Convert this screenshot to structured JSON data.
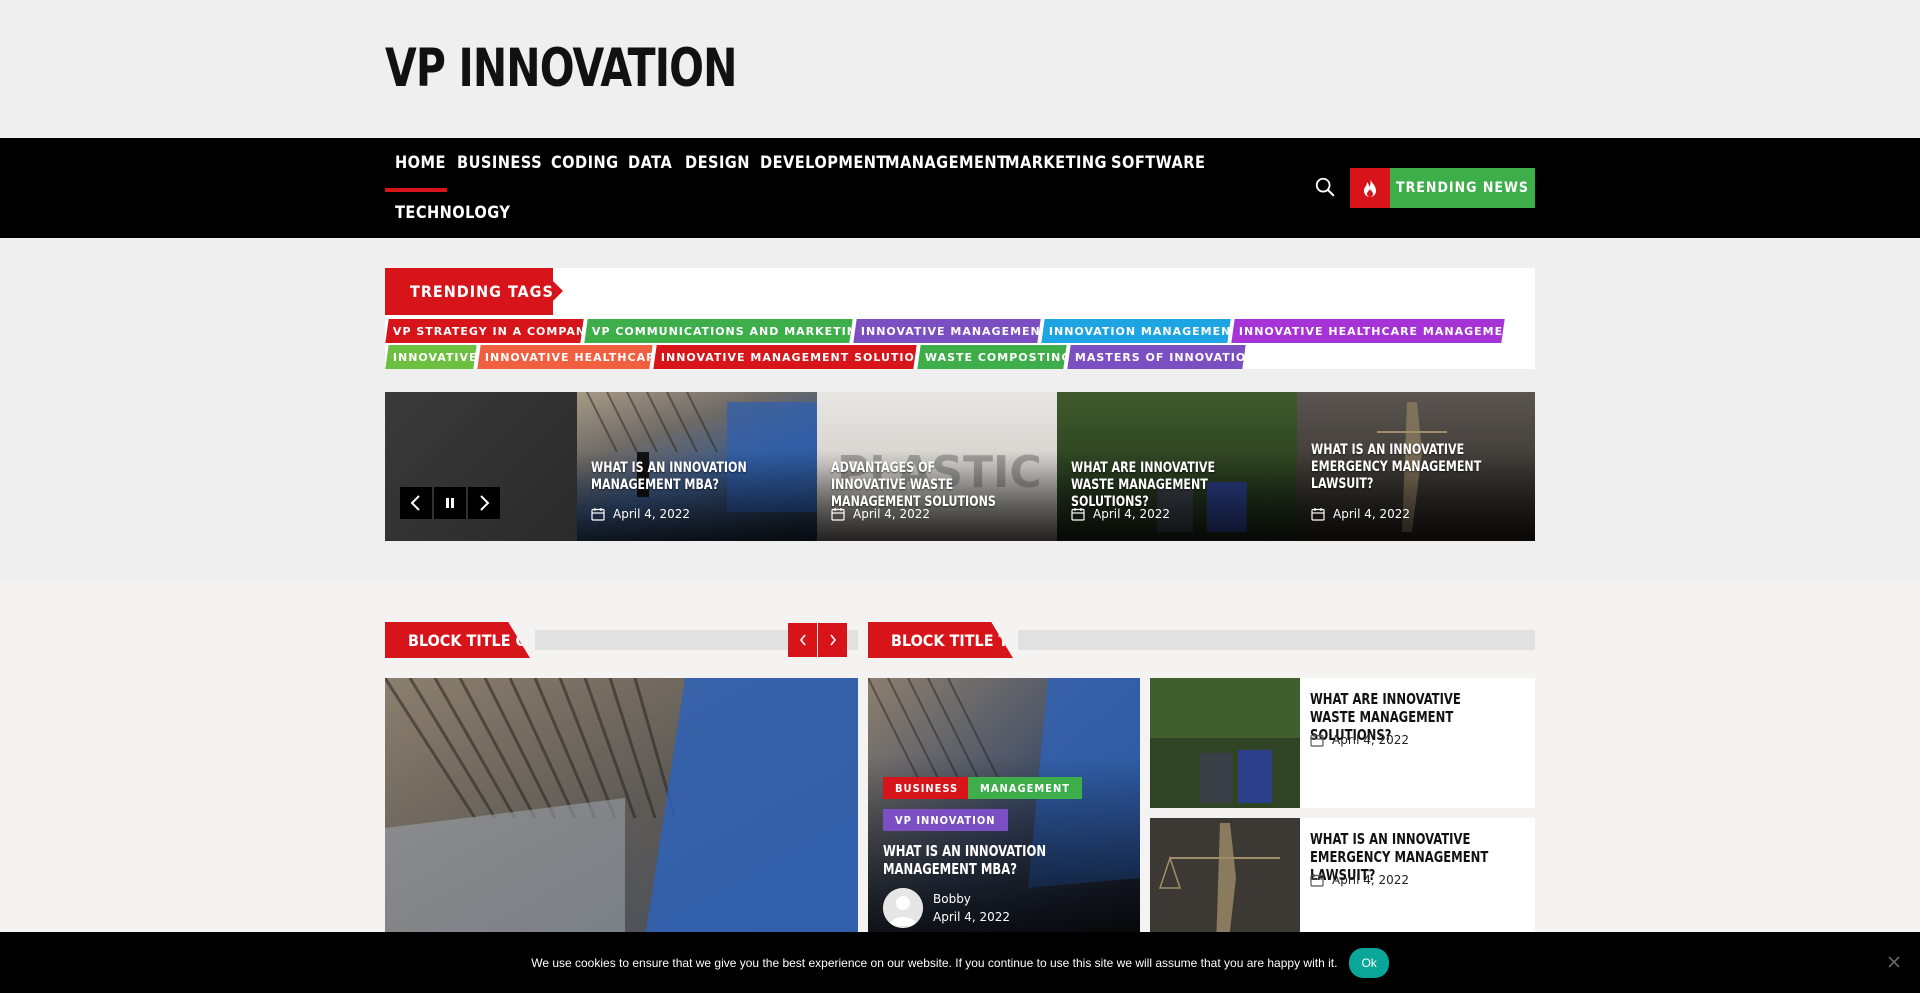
{
  "site": {
    "title": "VP INNOVATION"
  },
  "nav": {
    "items": [
      "HOME",
      "BUSINESS",
      "CODING",
      "DATA",
      "DESIGN",
      "DEVELOPMENT",
      "MANAGEMENT",
      "MARKETING",
      "SOFTWARE",
      "TECHNOLOGY"
    ],
    "active": "HOME",
    "trending_label": "TRENDING NEWS",
    "search_icon": "search-icon",
    "fire_icon": "fire-icon"
  },
  "trending_tags": {
    "title": "TRENDING TAGS",
    "tags": [
      {
        "label": "VP STRATEGY IN A COMPANY",
        "color": "#d7141a"
      },
      {
        "label": "VP COMMUNICATIONS AND MARKETING",
        "color": "#3eae4b"
      },
      {
        "label": "INNOVATIVE MANAGEMENT",
        "color": "#7b4fc2"
      },
      {
        "label": "INNOVATION MANAGEMENT",
        "color": "#1da5e3"
      },
      {
        "label": "INNOVATIVE HEALTHCARE MANAGEMENT",
        "color": "#a633d6"
      },
      {
        "label": "INNOVATIVE",
        "color": "#6cbf3f"
      },
      {
        "label": "INNOVATIVE HEALTHCARE",
        "color": "#f06040"
      },
      {
        "label": "INNOVATIVE MANAGEMENT SOLUTIONS",
        "color": "#d7141a"
      },
      {
        "label": "WASTE COMPOSTING",
        "color": "#3eae4b"
      },
      {
        "label": "MASTERS OF INNOVATION",
        "color": "#7b4fc2"
      }
    ]
  },
  "slider": {
    "slides": [
      {
        "title": "WHAT IS AN INNOVATION MANAGEMENT MBA?",
        "date": "April 4, 2022"
      },
      {
        "title": "ADVANTAGES OF INNOVATIVE WASTE MANAGEMENT SOLUTIONS",
        "date": "April 4, 2022"
      },
      {
        "title": "WHAT ARE INNOVATIVE WASTE MANAGEMENT SOLUTIONS?",
        "date": "April 4, 2022"
      },
      {
        "title": "WHAT IS AN INNOVATIVE EMERGENCY MANAGEMENT LAWSUIT?",
        "date": "April 4, 2022"
      }
    ]
  },
  "block_one": {
    "title": "BLOCK TITLE ONE"
  },
  "block_tab": {
    "title": "BLOCK TITLE TAB",
    "main": {
      "categories": [
        {
          "label": "BUSINESS",
          "color": "#d7141a"
        },
        {
          "label": "MANAGEMENT",
          "color": "#3eae4b"
        },
        {
          "label": "VP INNOVATION",
          "color": "#7b4fc2"
        }
      ],
      "title": "WHAT IS AN INNOVATION MANAGEMENT MBA?",
      "author": "Bobby",
      "date": "April 4, 2022"
    },
    "side": [
      {
        "title": "WHAT ARE INNOVATIVE WASTE MANAGEMENT SOLUTIONS?",
        "date": "April 4, 2022"
      },
      {
        "title": "WHAT IS AN INNOVATIVE EMERGENCY MANAGEMENT LAWSUIT?",
        "date": "April 4, 2022"
      }
    ]
  },
  "cookie": {
    "text": "We use cookies to ensure that we give you the best experience on our website. If you continue to use this site we will assume that you are happy with it.",
    "ok": "Ok"
  }
}
